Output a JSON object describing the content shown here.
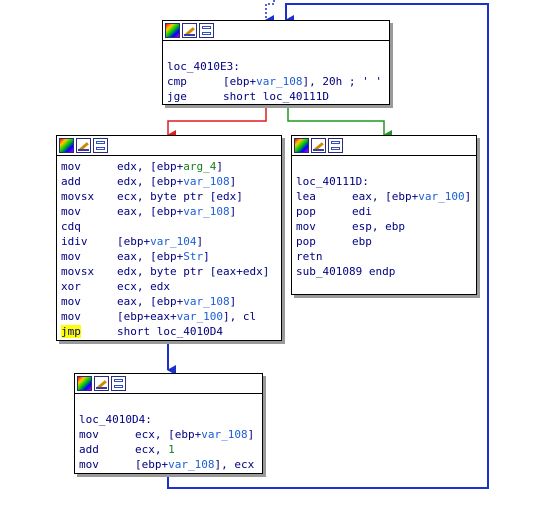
{
  "colors": {
    "edge_true": "#1d9a1d",
    "edge_false": "#e01b1b",
    "edge_uncond": "#1c2fcf",
    "text": "#000080",
    "highlight": "#ffff00"
  },
  "toolbar": {
    "icons": [
      "color-palette-icon",
      "rename-icon",
      "graph-overview-icon"
    ]
  },
  "nodes": {
    "loc_4010E3": {
      "label": "loc_4010E3:",
      "lines": [
        {
          "mn": "cmp",
          "a": "[ebp+",
          "b": "var_108",
          "c": "], 20h ; ' '"
        },
        {
          "mn": "jge",
          "a": "short loc_40111D",
          "b": "",
          "c": ""
        }
      ]
    },
    "block_body": {
      "lines": [
        {
          "mn": "mov",
          "a": "edx, [ebp+",
          "b": "arg_4",
          "c": "]"
        },
        {
          "mn": "add",
          "a": "edx, [ebp+",
          "b": "var_108",
          "c": "]"
        },
        {
          "mn": "movsx",
          "a": "ecx, byte ptr [edx]",
          "b": "",
          "c": ""
        },
        {
          "mn": "mov",
          "a": "eax, [ebp+",
          "b": "var_108",
          "c": "]"
        },
        {
          "mn": "cdq",
          "a": "",
          "b": "",
          "c": ""
        },
        {
          "mn": "idiv",
          "a": "[ebp+",
          "b": "var_104",
          "c": "]"
        },
        {
          "mn": "mov",
          "a": "eax, [ebp+",
          "b": "Str",
          "c": "]"
        },
        {
          "mn": "movsx",
          "a": "edx, byte ptr [eax+edx]",
          "b": "",
          "c": ""
        },
        {
          "mn": "xor",
          "a": "ecx, edx",
          "b": "",
          "c": ""
        },
        {
          "mn": "mov",
          "a": "eax, [ebp+",
          "b": "var_108",
          "c": "]"
        },
        {
          "mn": "mov",
          "a": "[ebp+eax+",
          "b": "var_100",
          "c": "], cl"
        },
        {
          "mn": "jmp",
          "a": "short loc_4010D4",
          "b": "",
          "c": ""
        }
      ]
    },
    "loc_40111D": {
      "label": "loc_40111D:",
      "lines": [
        {
          "mn": "lea",
          "a": "eax, [ebp+",
          "b": "var_100",
          "c": "]"
        },
        {
          "mn": "pop",
          "a": "edi",
          "b": "",
          "c": ""
        },
        {
          "mn": "mov",
          "a": "esp, ebp",
          "b": "",
          "c": ""
        },
        {
          "mn": "pop",
          "a": "ebp",
          "b": "",
          "c": ""
        },
        {
          "mn": "retn",
          "a": "",
          "b": "",
          "c": ""
        },
        {
          "mn": "sub_401089 endp",
          "a": "",
          "b": "",
          "c": ""
        }
      ]
    },
    "loc_4010D4": {
      "label": "loc_4010D4:",
      "lines": [
        {
          "mn": "mov",
          "a": "ecx, [ebp+",
          "b": "var_108",
          "c": "]"
        },
        {
          "mn": "add",
          "a": "ecx, ",
          "b": "1",
          "c": ""
        },
        {
          "mn": "mov",
          "a": "[ebp+",
          "b": "var_108",
          "c": "], ecx"
        }
      ]
    }
  }
}
